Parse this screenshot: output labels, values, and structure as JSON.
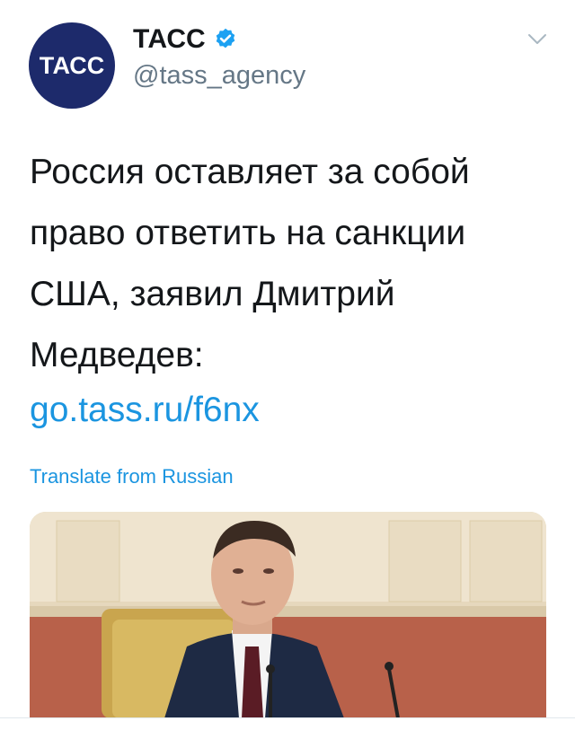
{
  "account": {
    "avatar_logo": "ТАСС",
    "display_name": "ТАСС",
    "handle": "@tass_agency",
    "verified_icon": "verified-badge-icon",
    "menu_icon": "chevron-down-icon"
  },
  "tweet": {
    "text": "Россия оставляет за собой\nправо ответить на санкции\nСША, заявил Дмитрий\nМедведев:",
    "link": "go.tass.ru/f6nx",
    "translate_label": "Translate from Russian",
    "media_icon": "photo-media"
  },
  "colors": {
    "link": "#1b95e0",
    "avatar_bg": "#1d2a6b",
    "handle": "#657786"
  }
}
